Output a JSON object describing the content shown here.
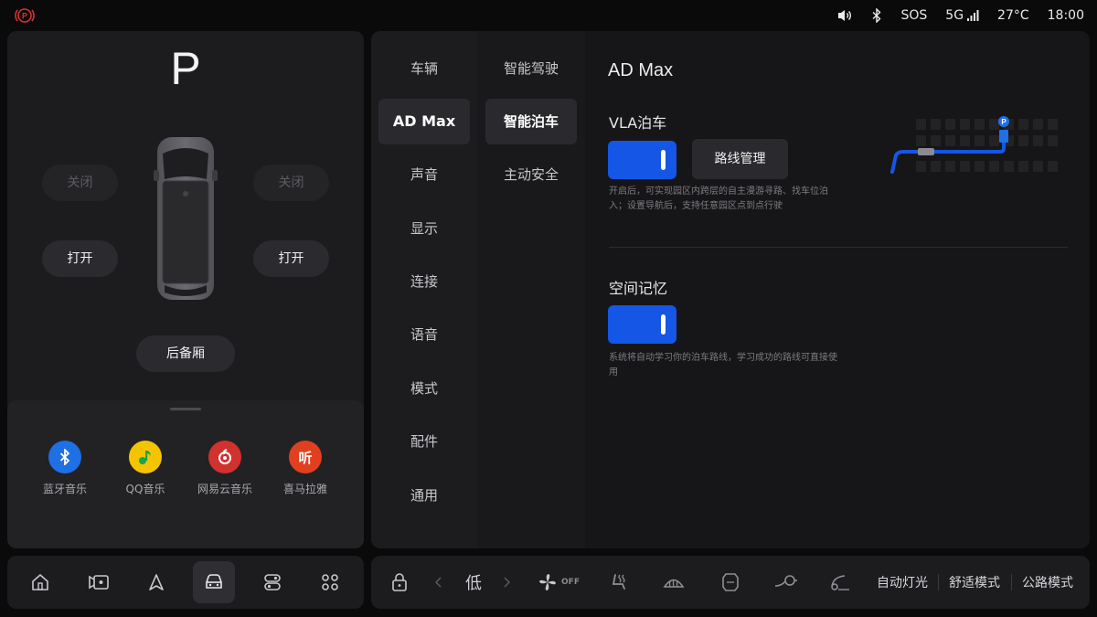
{
  "status_bar": {
    "sos": "SOS",
    "network": "5G",
    "temperature": "27°C",
    "time": "18:00",
    "icons": [
      "parking-brake-icon",
      "volume-icon",
      "bluetooth-icon",
      "signal-icon"
    ]
  },
  "vehicle": {
    "gear": "P",
    "left_window_close": "关闭",
    "right_window_close": "关闭",
    "left_door_open": "打开",
    "right_door_open": "打开",
    "trunk": "后备厢"
  },
  "apps": [
    {
      "label": "蓝牙音乐",
      "icon": "bluetooth-music-icon",
      "color": "#1f6fe5"
    },
    {
      "label": "QQ音乐",
      "icon": "qq-music-icon",
      "color": "#f5c400"
    },
    {
      "label": "网易云音乐",
      "icon": "netease-music-icon",
      "color": "#d2322d"
    },
    {
      "label": "喜马拉雅",
      "icon": "ximalaya-icon",
      "color": "#e0401f",
      "glyph": "听"
    }
  ],
  "settings_menu": [
    "车辆",
    "AD Max",
    "声音",
    "显示",
    "连接",
    "语音",
    "模式",
    "配件",
    "通用"
  ],
  "settings_menu_active": "AD Max",
  "sub_menu": [
    "智能驾驶",
    "智能泊车",
    "主动安全"
  ],
  "sub_menu_active": "智能泊车",
  "content": {
    "page_title": "AD Max",
    "vla": {
      "title": "VLA泊车",
      "enabled": true,
      "route_button": "路线管理",
      "desc": "开启后，可实现园区内跨层的自主漫游寻路、找车位泊入；设置导航后，支持任意园区点到点行驶"
    },
    "memory": {
      "title": "空间记忆",
      "enabled": true,
      "desc": "系统将自动学习你的泊车路线，学习成功的路线可直接使用"
    },
    "map_marker": "P"
  },
  "bottom_bar": {
    "fan_level": "低",
    "fan_state": "OFF",
    "auto_lights": "自动灯光",
    "comfort_mode": "舒适模式",
    "road_mode": "公路模式"
  },
  "colors": {
    "accent": "#1656e6",
    "panel": "#1c1c1f",
    "background": "#0a0a0b"
  }
}
